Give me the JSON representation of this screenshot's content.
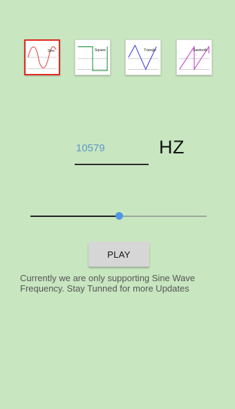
{
  "waveforms": {
    "selected": "sine",
    "items": [
      {
        "id": "sine",
        "label": "Sine",
        "color": "#e04a4a"
      },
      {
        "id": "square",
        "label": "Square",
        "color": "#2e9a4a"
      },
      {
        "id": "triangle",
        "label": "Triangle",
        "color": "#4a4ad8"
      },
      {
        "id": "sawtooth",
        "label": "Sawtooth",
        "color": "#c84ac8"
      }
    ]
  },
  "frequency": {
    "value": "10579",
    "unit": "HZ"
  },
  "slider": {
    "value": 0.5
  },
  "play_button": {
    "label": "PLAY"
  },
  "info": {
    "text": "Currently we are only supporting Sine Wave Frequency. Stay Tunned for more Updates"
  },
  "colors": {
    "background": "#c8e6c0",
    "selected_border": "#e0281e",
    "accent": "#4f97e6",
    "input_text": "#5f97c8"
  }
}
